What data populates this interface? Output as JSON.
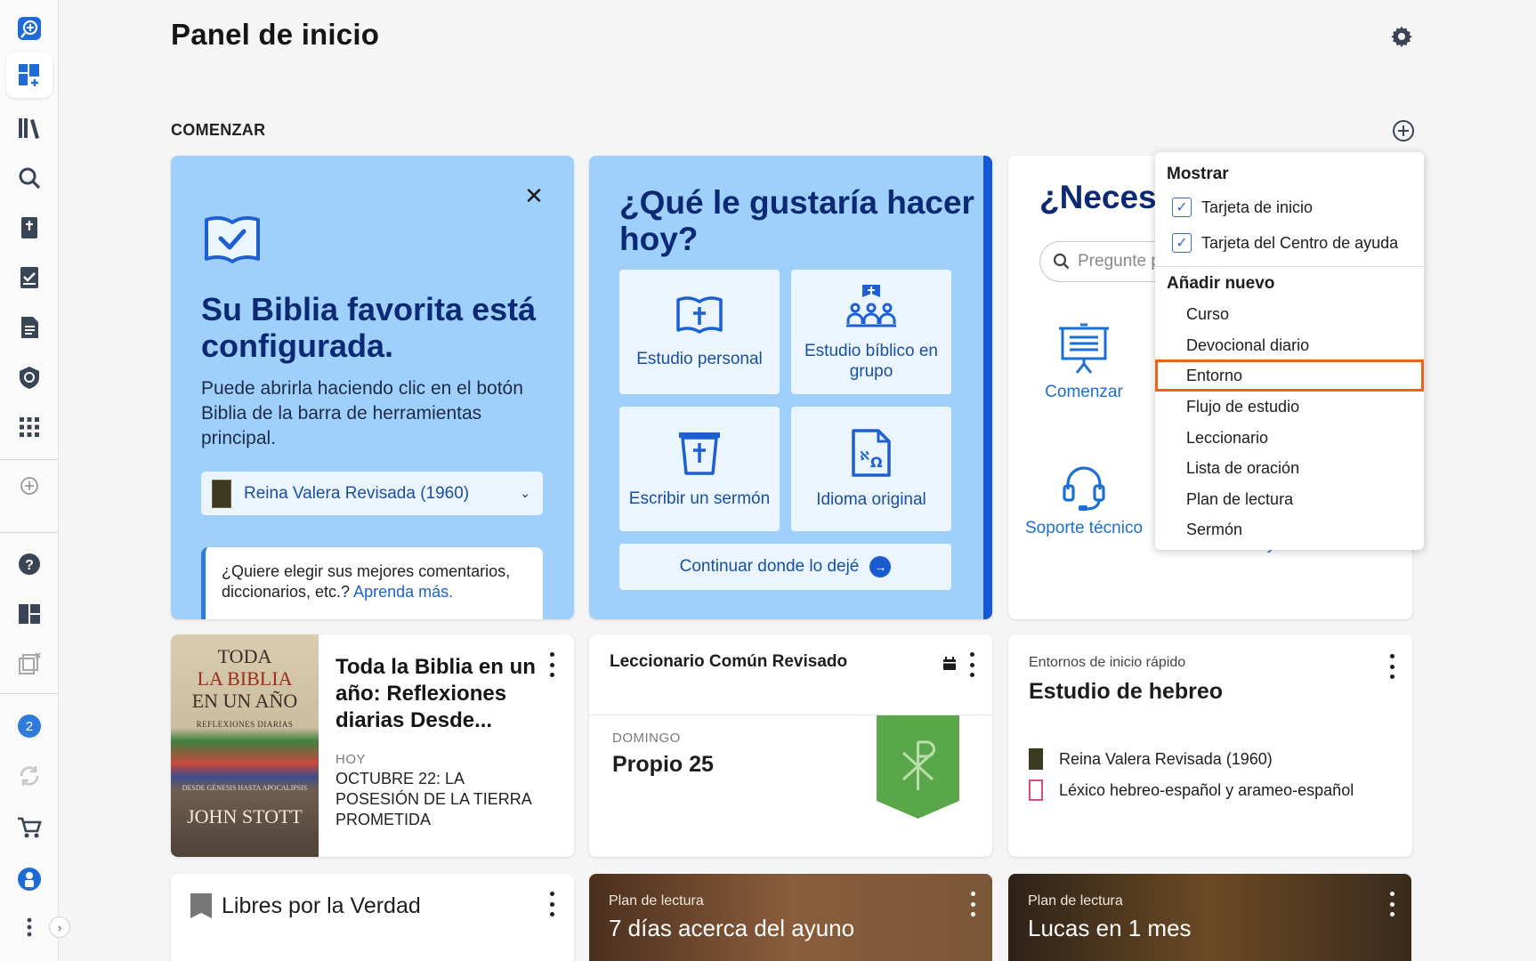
{
  "header": {
    "title": "Panel de inicio"
  },
  "section": {
    "label": "COMENZAR"
  },
  "sidebar": {
    "notification_count": "2"
  },
  "bible_card": {
    "title": "Su Biblia favorita está configurada.",
    "description": "Puede abrirla haciendo clic en el botón Biblia de la barra de herramientas principal.",
    "selected_bible": "Reina Valera Revisada (1960)",
    "tip_text": "¿Quiere elegir sus mejores comentarios, diccionarios, etc.?",
    "tip_link": "Aprenda más."
  },
  "todo_card": {
    "title": "¿Qué le gustaría hacer hoy?",
    "tiles": [
      {
        "label": "Estudio personal",
        "icon": "open-bible-icon"
      },
      {
        "label": "Estudio bíblico en grupo",
        "icon": "group-study-icon"
      },
      {
        "label": "Escribir un sermón",
        "icon": "pulpit-icon"
      },
      {
        "label": "Idioma original",
        "icon": "original-language-icon"
      }
    ],
    "continue_label": "Continuar donde lo dejé"
  },
  "help_card": {
    "title": "¿Neces",
    "search_placeholder": "Pregunte p",
    "items": [
      {
        "label": "Comenzar",
        "icon": "presentation-icon"
      },
      {
        "label": "Soporte técnico",
        "icon": "headset-icon"
      },
      {
        "label": "Ayuda"
      }
    ]
  },
  "add_menu": {
    "show_heading": "Mostrar",
    "show_items": [
      {
        "label": "Tarjeta de inicio",
        "checked": true
      },
      {
        "label": "Tarjeta del Centro de ayuda",
        "checked": true
      }
    ],
    "add_heading": "Añadir nuevo",
    "add_items": [
      "Curso",
      "Devocional diario",
      "Entorno",
      "Flujo de estudio",
      "Leccionario",
      "Lista de oración",
      "Plan de lectura",
      "Sermón"
    ],
    "highlighted": "Entorno"
  },
  "year_card": {
    "cover_line1": "TODA",
    "cover_line2": "LA BIBLIA",
    "cover_line3": "EN UN AÑO",
    "cover_subtitle": "REFLEXIONES DIARIAS",
    "cover_range": "DESDE GÉNESIS HASTA APOCALIPSIS",
    "cover_author": "JOHN STOTT",
    "title": "Toda la Biblia en un año: Reflexiones diarias Desde...",
    "today_label": "HOY",
    "reading": "OCTUBRE 22: LA POSESIÓN DE LA TIERRA PROMETIDA"
  },
  "lectionary_card": {
    "title": "Leccionario Común Revisado",
    "day_label": "DOMINGO",
    "name": "Propio 25",
    "banner_color": "#5aa64a"
  },
  "environment_card": {
    "label": "Entornos de inicio rápido",
    "title": "Estudio de hebreo",
    "resources": [
      "Reina Valera Revisada (1960)",
      "Léxico hebreo-español y arameo-español"
    ]
  },
  "free_card": {
    "title": "Libres por la Verdad"
  },
  "fast_card": {
    "label": "Plan de lectura",
    "title": "7 días acerca del ayuno"
  },
  "luke_card": {
    "label": "Plan de lectura",
    "title": "Lucas en 1 mes"
  },
  "colors": {
    "accent": "#1559d6",
    "card_blue": "#9fd0fb",
    "highlight": "#e8641f"
  }
}
